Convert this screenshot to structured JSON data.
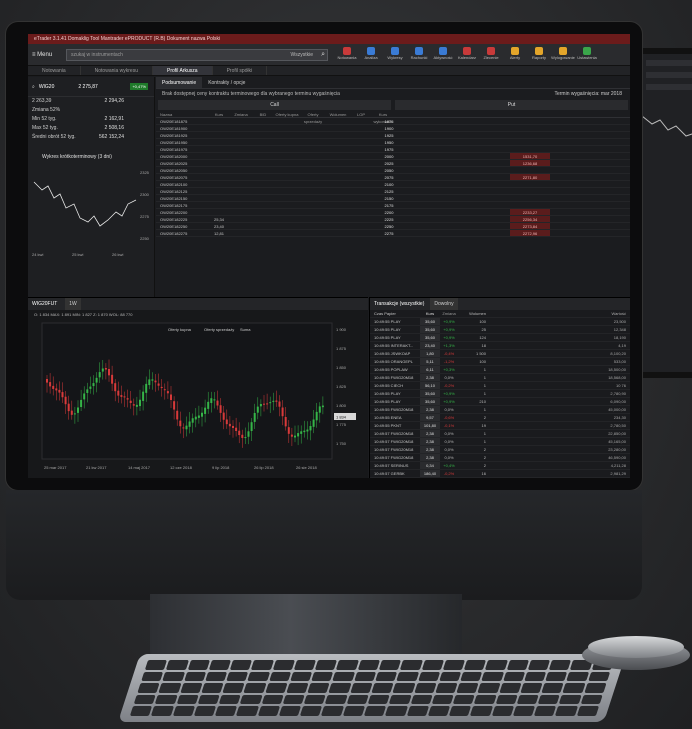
{
  "app": {
    "title": "eTrader 3.1.41 Domaklig Tool Mantrader ePRODUCT (R.B) Dokument nazwa Polski",
    "menu_label": "Menu",
    "search_placeholder": "szukaj w instrumentach",
    "search_mode": "Wszystkie"
  },
  "toolbar": [
    {
      "label": "Notowania",
      "color": "#c83a3a"
    },
    {
      "label": "Analiza",
      "color": "#3a7bd5"
    },
    {
      "label": "Wykresy",
      "color": "#3a7bd5"
    },
    {
      "label": "Rachunki",
      "color": "#3a7bd5"
    },
    {
      "label": "Aktywność",
      "color": "#3a7bd5"
    },
    {
      "label": "Kalendarz",
      "color": "#c83a3a"
    },
    {
      "label": "Zlecenie",
      "color": "#c83a3a"
    },
    {
      "label": "Alerty",
      "color": "#e3a52a"
    },
    {
      "label": "Raporty",
      "color": "#e3a52a"
    },
    {
      "label": "Wylogowanie",
      "color": "#e3a52a"
    },
    {
      "label": "Ustawienia",
      "color": "#3aa54a"
    }
  ],
  "tabs": [
    "Notowania",
    "Notowania wykresu",
    "Profil Arkusza",
    "Profil spółki"
  ],
  "left": {
    "symbol": "WIG20",
    "symbol_sub": "WIG20",
    "price": "2 275,87",
    "change": "+0,47%",
    "stats": [
      {
        "label": "2 263,39",
        "value": "2 294,26"
      },
      {
        "label": "Zmiana 52%",
        "value": ""
      },
      {
        "label": "Min 52 tyg.",
        "value": "2 162,91"
      },
      {
        "label": "Max 52 tyg.",
        "value": "2 508,16"
      },
      {
        "label": "Średni obrót 52 tyg.",
        "value": "562 152,24"
      }
    ],
    "intraday_title": "Wykres krótkoterminowy (3 dni)",
    "axis_labels": [
      "24 kwi",
      "25 kwi",
      "26 kwi"
    ],
    "right_axis": [
      "2325",
      "2300",
      "2275",
      "2250"
    ]
  },
  "options": {
    "subtabs": [
      "Podsumowanie",
      "Kontrakty / opcje"
    ],
    "note": "Brak dostępnej ceny kontraktu terminowego dla wybranego terminu wygaśnięcia",
    "call_label": "Call",
    "put_label": "Put",
    "expiry_label": "Termin wygaśnięcia: mar 2018",
    "headers": [
      "Nazwa",
      "Kurs",
      "Zmiana",
      "BID",
      "Oferty kupna",
      "Oferty sprzedaży",
      "Wolumen",
      "LOP",
      "Kurs wykonania"
    ],
    "rows": [
      {
        "name": "OW20E181875",
        "mid": "1875",
        "left": "",
        "right": ""
      },
      {
        "name": "OW20E181900",
        "mid": "1900",
        "left": "",
        "right": ""
      },
      {
        "name": "OW20E181925",
        "mid": "1925",
        "left": "",
        "right": ""
      },
      {
        "name": "OW20E181950",
        "mid": "1950",
        "left": "",
        "right": ""
      },
      {
        "name": "OW20E181975",
        "mid": "1975",
        "left": "",
        "right": ""
      },
      {
        "name": "OW20E182000",
        "mid": "2000",
        "left": "",
        "right": "1531,70"
      },
      {
        "name": "OW20E182025",
        "mid": "2025",
        "left": "",
        "right": "1236,68"
      },
      {
        "name": "OW20E182050",
        "mid": "2050",
        "left": "",
        "right": ""
      },
      {
        "name": "OW20E182075",
        "mid": "2075",
        "left": "",
        "right": "2271,80"
      },
      {
        "name": "OW20E182100",
        "mid": "2100",
        "left": "",
        "right": ""
      },
      {
        "name": "OW20E182125",
        "mid": "2125",
        "left": "",
        "right": ""
      },
      {
        "name": "OW20E182150",
        "mid": "2150",
        "left": "",
        "right": ""
      },
      {
        "name": "OW20E182175",
        "mid": "2175",
        "left": "",
        "right": ""
      },
      {
        "name": "OW20E182200",
        "mid": "2200",
        "left": "",
        "right": "2233,27"
      },
      {
        "name": "OW20E182225",
        "mid": "2225",
        "left": "25,34",
        "right": "2256,34"
      },
      {
        "name": "OW20E182250",
        "mid": "2250",
        "left": "23,40",
        "right": "2273,84"
      },
      {
        "name": "OW20E182275",
        "mid": "2275",
        "left": "12,81",
        "right": "2272,96"
      }
    ]
  },
  "chart": {
    "toolbar_label": "WIG20FUT",
    "interval": "1W",
    "ohlc_label": "O: 1 834  MAX: 1 891  MIN: 1 827  Z: 1 870  WOL: 88 770",
    "order_popup_headers": [
      "Oferty kupna",
      "Oferty sprzedaży",
      "Suma"
    ],
    "x_labels": [
      "25 mar 2017",
      "21 kw 2017",
      "14 maj 2017",
      "12 cze 2018",
      "9 lip 2018",
      "26 lip 2018",
      "26 sie 2018"
    ],
    "y_labels": [
      "1 900",
      "1 875",
      "1 850",
      "1 825",
      "1 800",
      "1 775",
      "1 750"
    ],
    "last_price": "1 834"
  },
  "trades": {
    "title": "Transakcje (wszystkie)",
    "filter": "Dowolny",
    "headers": [
      "Czas Papier",
      "Kurs",
      "Zmiana",
      "Wolumen",
      "Wartość"
    ],
    "rows": [
      {
        "time": "10:49:55 PLAY",
        "price": "35,60",
        "pct": "+0,9%",
        "vol": "100",
        "side": "23,500"
      },
      {
        "time": "10:49:55 PLAY",
        "price": "35,60",
        "pct": "+0,9%",
        "vol": "25",
        "side": "12,348"
      },
      {
        "time": "10:49:55 PLAY",
        "price": "35,60",
        "pct": "+0,9%",
        "vol": "124",
        "side": "18,190"
      },
      {
        "time": "10:49:55 INTERAKT...",
        "price": "23,40",
        "pct": "+1,3%",
        "vol": "18",
        "side": "4,19"
      },
      {
        "time": "10:49:55 JSWKOAP",
        "price": "1,80",
        "pct": "-0,4%",
        "vol": "1 500",
        "side": "8,100,20"
      },
      {
        "time": "10:49:55 ORANGEPL",
        "price": "5,11",
        "pct": "-1,2%",
        "vol": "100",
        "side": "533,00"
      },
      {
        "time": "10:49:55 POPLAW",
        "price": "6,11",
        "pct": "+0,3%",
        "vol": "1",
        "side": "18,500,00"
      },
      {
        "time": "10:49:55 FWIG20M18",
        "price": "2,38",
        "pct": "0,0%",
        "vol": "1",
        "side": "18,568,00"
      },
      {
        "time": "10:49:55 CIECH",
        "price": "56,10",
        "pct": "-0,2%",
        "vol": "1",
        "side": "10 76"
      },
      {
        "time": "10:49:55 PLAY",
        "price": "35,60",
        "pct": "+0,9%",
        "vol": "1",
        "side": "2,780,90"
      },
      {
        "time": "10:49:55 PLAY",
        "price": "35,60",
        "pct": "+0,9%",
        "vol": "210",
        "side": "6,090,00"
      },
      {
        "time": "10:49:55 FWIG20M18",
        "price": "2,38",
        "pct": "0,0%",
        "vol": "1",
        "side": "45,000,00"
      },
      {
        "time": "10:49:55 ENEA",
        "price": "9,57",
        "pct": "-0,6%",
        "vol": "2",
        "side": "234,30"
      },
      {
        "time": "10:49:55 PKNT",
        "price": "101,80",
        "pct": "-0,1%",
        "vol": "19",
        "side": "2,780,50"
      },
      {
        "time": "10:49:57 FWIG20M18",
        "price": "2,38",
        "pct": "0,0%",
        "vol": "1",
        "side": "22,850,00"
      },
      {
        "time": "10:49:57 FWIG20M18",
        "price": "2,38",
        "pct": "0,0%",
        "vol": "1",
        "side": "45,165,00"
      },
      {
        "time": "10:49:57 FWIG20M18",
        "price": "2,38",
        "pct": "0,0%",
        "vol": "2",
        "side": "23,280,00"
      },
      {
        "time": "10:49:57 FWIG20M18",
        "price": "2,38",
        "pct": "0,0%",
        "vol": "2",
        "side": "46,590,00"
      },
      {
        "time": "10:49:57 SERINUS",
        "price": "0,34",
        "pct": "+0,4%",
        "vol": "2",
        "side": "4,211,28"
      },
      {
        "time": "10:49:57 GERBK",
        "price": "186,40",
        "pct": "-0,2%",
        "vol": "16",
        "side": "2,981,29"
      },
      {
        "time": "10:49:57 ASSECOPOL",
        "price": "43,56",
        "pct": "-0,1%",
        "vol": "1",
        "side": "43,56"
      }
    ]
  }
}
